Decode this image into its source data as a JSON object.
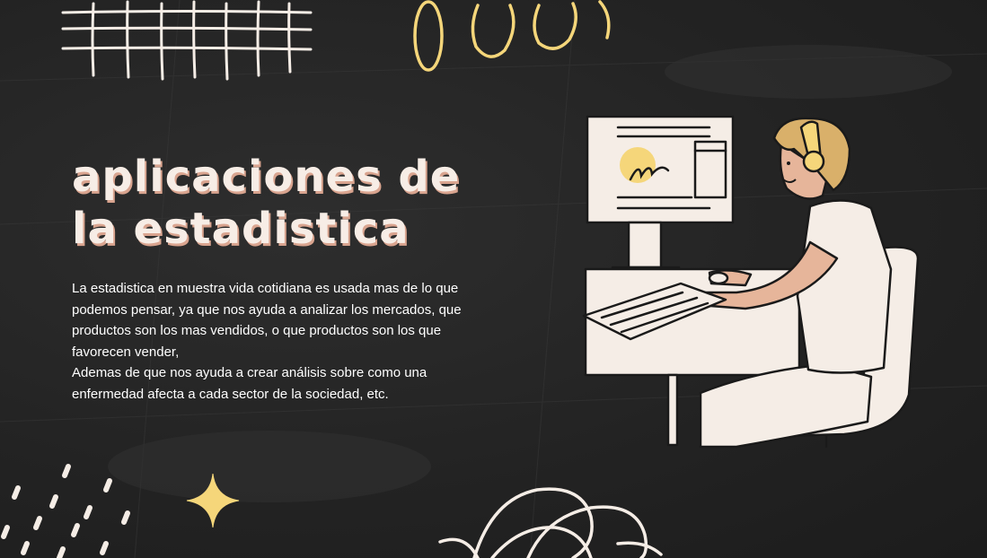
{
  "slide": {
    "title_line1": "aplicaciones de",
    "title_line2": "la estadistica",
    "paragraph1": "La estadistica en muestra vida cotidiana es usada mas de lo que podemos pensar, ya que nos ayuda a analizar los mercados, que productos son los mas vendidos, o que productos son los que favorecen vender,",
    "paragraph2": "Ademas de que nos ayuda a crear análisis sobre como una enfermedad afecta a cada sector de la sociedad, etc."
  },
  "decorations": {
    "grid": "grid-doodle",
    "ovals": "oval-doodles",
    "illustration": "person-at-computer-illustration",
    "sparkle": "sparkle-star-icon",
    "dashes": "dash-marks-doodle",
    "scribble": "scribble-loops-doodle"
  },
  "colors": {
    "background": "#262626",
    "cream": "#f5ede6",
    "yellow": "#f5d67a",
    "title_shadow": "#d9a48f",
    "skin": "#e6b59a",
    "hair": "#d9b06a"
  }
}
